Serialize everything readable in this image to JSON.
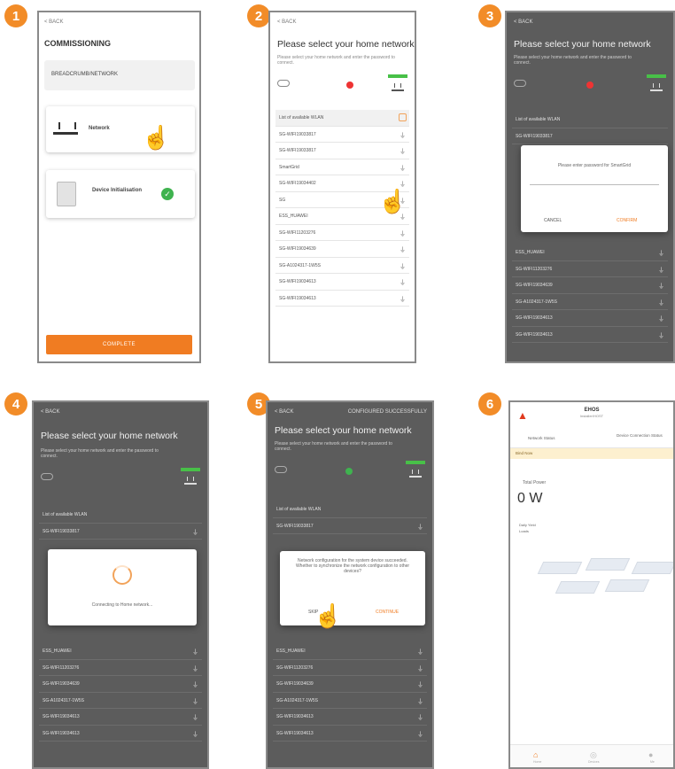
{
  "steps": [
    "1",
    "2",
    "3",
    "4",
    "5",
    "6"
  ],
  "screen1": {
    "back": "< BACK",
    "title": "COMMISSIONING",
    "breadcrumb": "BREADCRUMB/NETWORK",
    "network_label": "Network",
    "device_label": "Device Initialisation",
    "complete_button": "COMPLETE"
  },
  "network_screen": {
    "back": "< BACK",
    "title": "Please select your home network",
    "subtitle": "Please select your home network and enter the password to connect.",
    "list_header": "List of available WLAN",
    "networks": [
      "SG-WIFI19033817",
      "SG-WIFI19033817",
      "SmartGrid",
      "SG-WIFI19034402",
      "SG",
      "ESS_HUAWEI",
      "SG-WIFI11203276",
      "SG-WIFI19034639",
      "SG-A1024317-1W5S",
      "SG-WIFI19034613",
      "SG-WIFI19034613"
    ]
  },
  "screen3": {
    "dialog_text": "Please enter password for SmartGrid",
    "cancel": "CANCEL",
    "confirm": "CONFIRM",
    "networks_below": [
      "ESS_HUAWEI",
      "SG-WIFI11203276",
      "SG-WIFI19034639",
      "SG-A1024317-1W5S",
      "SG-WIFI19034613",
      "SG-WIFI19034613"
    ]
  },
  "screen4": {
    "dialog_text": "Connecting to Home network...",
    "networks_below": [
      "ESS_HUAWEI",
      "SG-WIFI11203276",
      "SG-WIFI19034639",
      "SG-A1024317-1W5S",
      "SG-WIFI19034613",
      "SG-WIFI19034613"
    ]
  },
  "screen5": {
    "header_right": "CONFIGURED SUCCESSFULLY",
    "dialog_text": "Network configuration for the system device succeeded. Whether to synchronize the network configuration to other devices?",
    "skip": "SKIP",
    "continue": "CONTINUE",
    "networks_below": [
      "ESS_HUAWEI",
      "SG-WIFI11203276",
      "SG-WIFI19034639",
      "SG-A1024317-1W5S",
      "SG-WIFI19034613",
      "SG-WIFI19034613"
    ]
  },
  "screen6": {
    "title": "EHOS",
    "subtitle": "Installer/HOST",
    "status_left": "Network Status",
    "status_right": "Device Connection Status",
    "banner": "Bind Now",
    "total_power_label": "Total Power",
    "total_power_value": "0 W",
    "daily_label": "Daily Yield",
    "daily_sub": "Loads",
    "tabs": [
      "Home",
      "Devices",
      "Me"
    ]
  },
  "colors": {
    "accent": "#f07c22",
    "badge": "#f28c28",
    "success": "#3fb34f",
    "error": "#e33333"
  }
}
